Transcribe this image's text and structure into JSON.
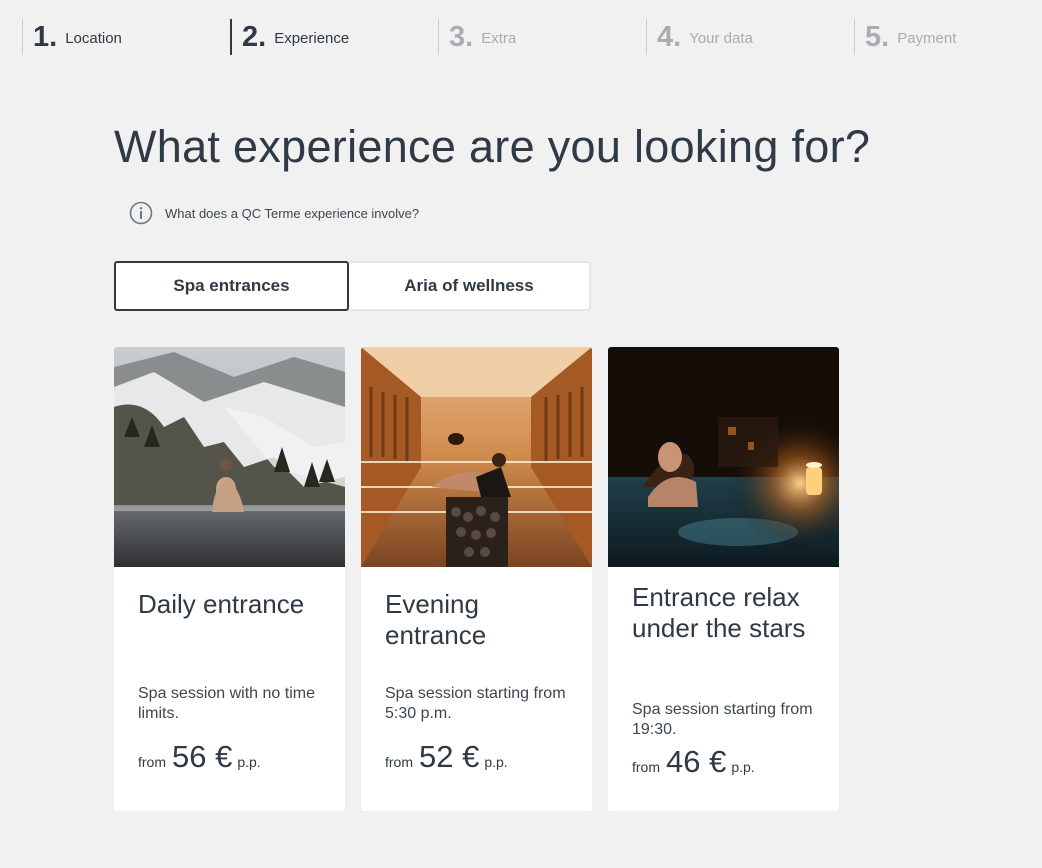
{
  "stepper": {
    "steps": [
      {
        "num": "1.",
        "label": "Location"
      },
      {
        "num": "2.",
        "label": "Experience"
      },
      {
        "num": "3.",
        "label": "Extra"
      },
      {
        "num": "4.",
        "label": "Your data"
      },
      {
        "num": "5.",
        "label": "Payment"
      }
    ],
    "current_step": 2
  },
  "main": {
    "title": "What experience are you looking for?",
    "info_link": "What does a QC Terme experience involve?",
    "tabs": [
      {
        "label": "Spa entrances",
        "selected": true
      },
      {
        "label": "Aria of wellness",
        "selected": false
      }
    ],
    "cards": [
      {
        "title": "Daily entrance",
        "description": "Spa session with no time limits.",
        "from": "from",
        "price": "56 €",
        "per": "p.p.",
        "image": "woman-sitting-in-outdoor-pool-snowy-mountains"
      },
      {
        "title": "Evening entrance",
        "description": "Spa session starting from 5:30 p.m.",
        "from": "from",
        "price": "52 €",
        "per": "p.p.",
        "image": "couple-in-wooden-sauna"
      },
      {
        "title": "Entrance relax under the stars",
        "description": "Spa session starting from 19:30.",
        "from": "from",
        "price": "46 €",
        "per": "p.p.",
        "image": "woman-in-pool-at-night-candle"
      }
    ]
  },
  "colors": {
    "background": "#f1f1f1",
    "text_primary": "#2f3a45",
    "step_inactive": "#a9acb0"
  }
}
